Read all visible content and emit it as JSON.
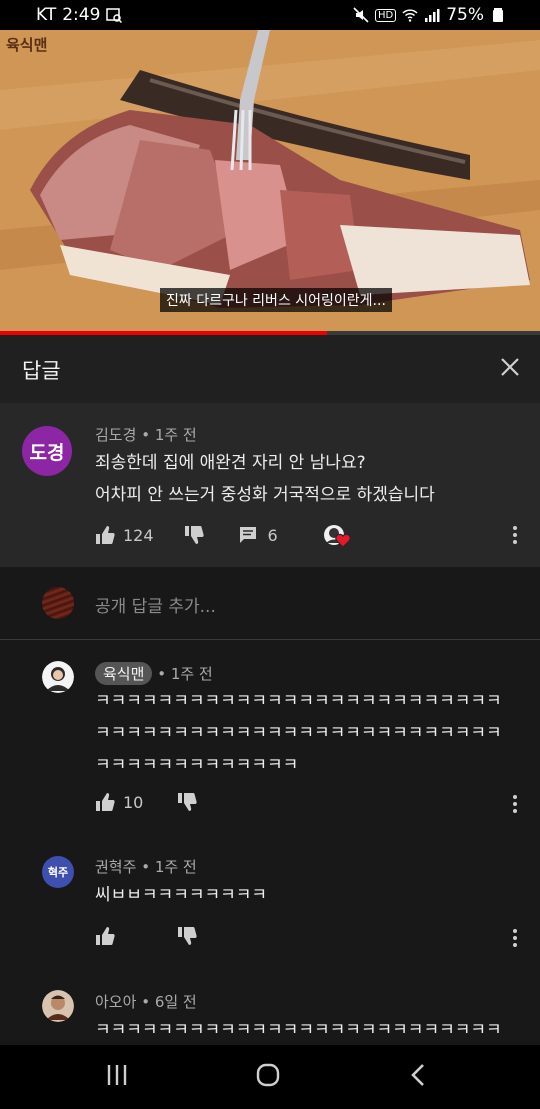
{
  "status_bar": {
    "carrier": "KT",
    "time": "2:49",
    "hd": "HD",
    "battery": "75%"
  },
  "video": {
    "watermark": "육식맨",
    "subtitle": "진짜 다르구나 리버스 시어링이란게...",
    "progress": 0.605
  },
  "replies_panel": {
    "title": "답글"
  },
  "main_comment": {
    "avatar_text": "도경",
    "author": "김도경",
    "time": "1주 전",
    "lines": [
      "죄송한데 집에 애완견 자리 안 남나요?",
      "어차피 안 쓰는거 중성화 거국적으로 하겠습니다"
    ],
    "likes": "124",
    "replies": "6",
    "avatar_color": "#8c26a5"
  },
  "add_reply": {
    "placeholder": "공개 답글 추가..."
  },
  "replies": [
    {
      "author": "육식맨",
      "time": "1주 전",
      "lines": [
        "ㅋㅋㅋㅋㅋㅋㅋㅋㅋㅋㅋㅋㅋㅋㅋㅋㅋㅋㅋㅋㅋㅋㅋㅋㅋㅋ",
        "ㅋㅋㅋㅋㅋㅋㅋㅋㅋㅋㅋㅋㅋㅋㅋㅋㅋㅋㅋㅋㅋㅋㅋㅋㅋㅋ",
        "ㅋㅋㅋㅋㅋㅋㅋㅋㅋㅋㅋㅋㅋ"
      ],
      "likes": "10"
    },
    {
      "avatar_text": "혁주",
      "author": "권혁주",
      "time": "1주 전",
      "lines": [
        "씨ㅂㅂㅋㅋㅋㅋㅋㅋㅋㅋ"
      ],
      "avatar_color": "#3f4fb0"
    },
    {
      "author": "아오아",
      "time": "6일 전",
      "lines": [
        "ㅋㅋㅋㅋㅋㅋㅋㅋㅋㅋㅋㅋㅋㅋㅋㅋㅋㅋㅋㅋㅋㅋㅋㅋㅋㅋ"
      ]
    }
  ]
}
